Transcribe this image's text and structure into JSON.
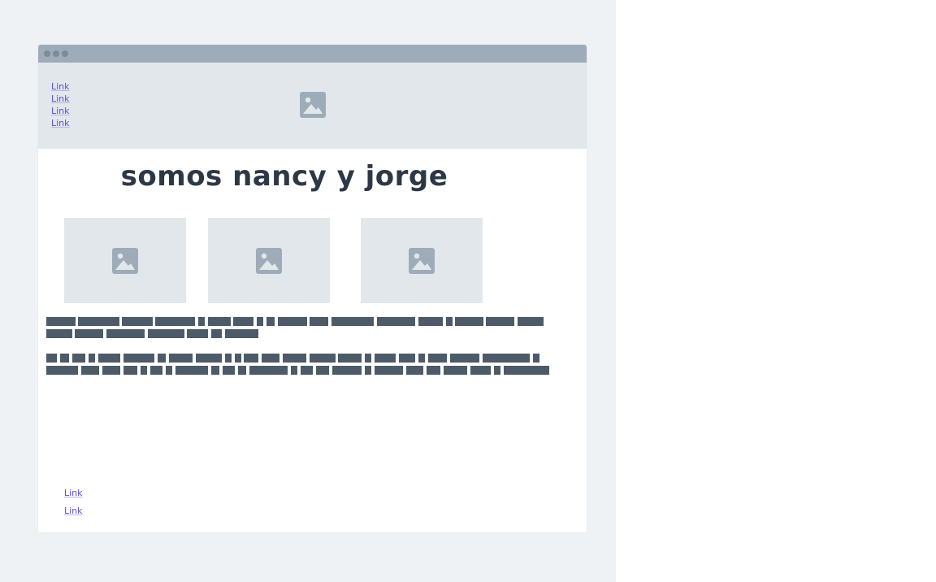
{
  "header": {
    "nav_links": [
      {
        "label": "Link"
      },
      {
        "label": "Link"
      },
      {
        "label": "Link"
      },
      {
        "label": "Link"
      }
    ],
    "logo_icon": "image-placeholder-icon"
  },
  "main": {
    "headline": "somos nancy y jorge",
    "thumbnails": [
      {
        "icon": "image-placeholder-icon"
      },
      {
        "icon": "image-placeholder-icon"
      },
      {
        "icon": "image-placeholder-icon"
      }
    ]
  },
  "footer": {
    "links": [
      {
        "label": "Link"
      },
      {
        "label": "Link"
      }
    ]
  },
  "colors": {
    "background": "#eff2f5",
    "titlebar": "#9eacb9",
    "header": "#e2e7ec",
    "placeholder_icon": "#9eacb9",
    "text_bar": "#4d5a67",
    "link": "#5a4fd6",
    "headline": "#2c3845"
  }
}
